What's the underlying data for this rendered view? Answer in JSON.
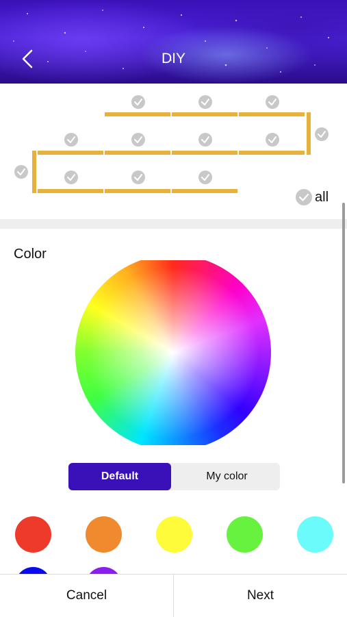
{
  "header": {
    "title": "DIY",
    "back_icon": "chevron-left-icon"
  },
  "strip": {
    "select_all_label": "all",
    "check_icon": "check-circle-icon",
    "segment_color": "#e6b23c"
  },
  "color_section": {
    "label": "Color",
    "tabs": [
      {
        "label": "Default",
        "selected": true
      },
      {
        "label": "My color",
        "selected": false
      }
    ],
    "accent": "#3a10b8",
    "swatches": [
      "#ee3a2a",
      "#ef8a2e",
      "#fdfb3a",
      "#66f23e",
      "#6cfbfb",
      "#0a0af0",
      "#8a1ef0"
    ]
  },
  "footer": {
    "cancel_label": "Cancel",
    "next_label": "Next"
  }
}
